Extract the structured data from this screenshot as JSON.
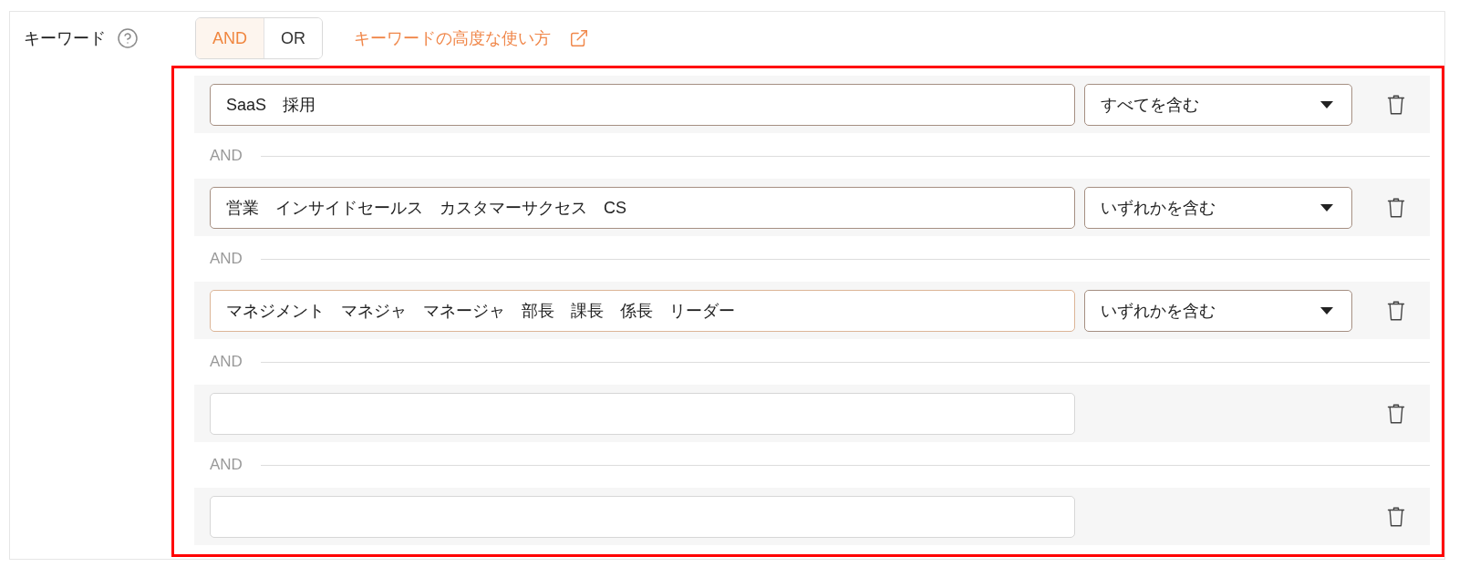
{
  "keyword_filter": {
    "label": "キーワード",
    "operator_toggle": [
      {
        "label": "AND",
        "selected": true
      },
      {
        "label": "OR",
        "selected": false
      }
    ],
    "help_link": "キーワードの高度な使い方",
    "highlighted": true,
    "rules": [
      {
        "value": "SaaS　採用",
        "match": "すべてを含む",
        "focused": false
      },
      {
        "connector": "AND",
        "value": "営業　インサイドセールス　カスタマーサクセス　CS",
        "match": "いずれかを含む",
        "focused": false
      },
      {
        "connector": "AND",
        "value": "マネジメント　マネジャ　マネージャ　部長　課長　係長　リーダー",
        "match": "いずれかを含む",
        "focused": true
      },
      {
        "connector": "AND",
        "focused": false
      },
      {
        "connector": "AND",
        "focused": false
      }
    ]
  }
}
